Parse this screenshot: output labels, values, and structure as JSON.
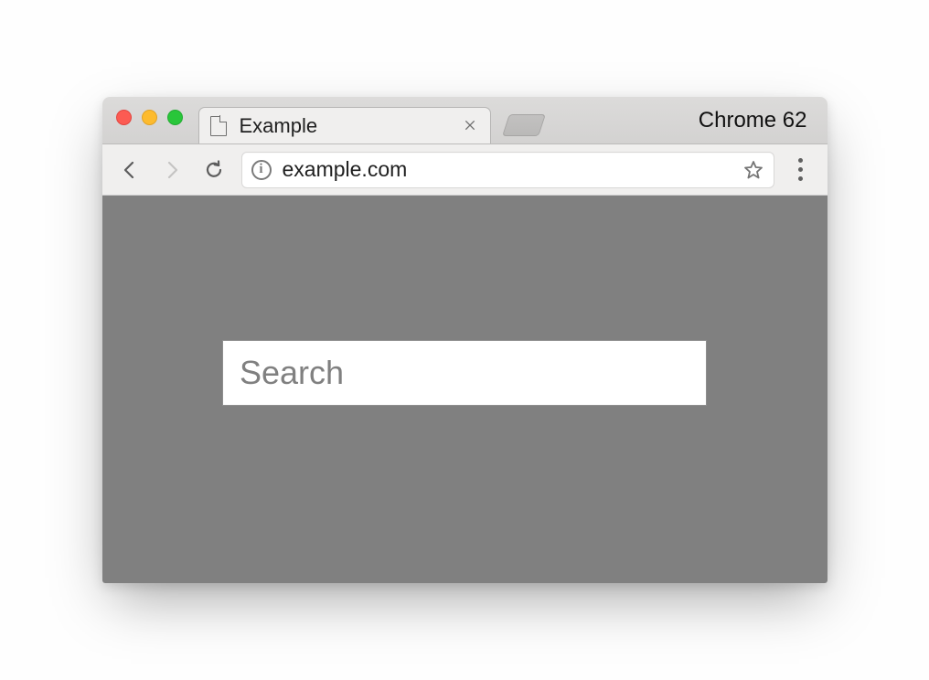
{
  "window": {
    "tab_title": "Example",
    "browser_label": "Chrome 62"
  },
  "toolbar": {
    "url": "example.com"
  },
  "page": {
    "search_placeholder": "Search",
    "search_value": ""
  }
}
